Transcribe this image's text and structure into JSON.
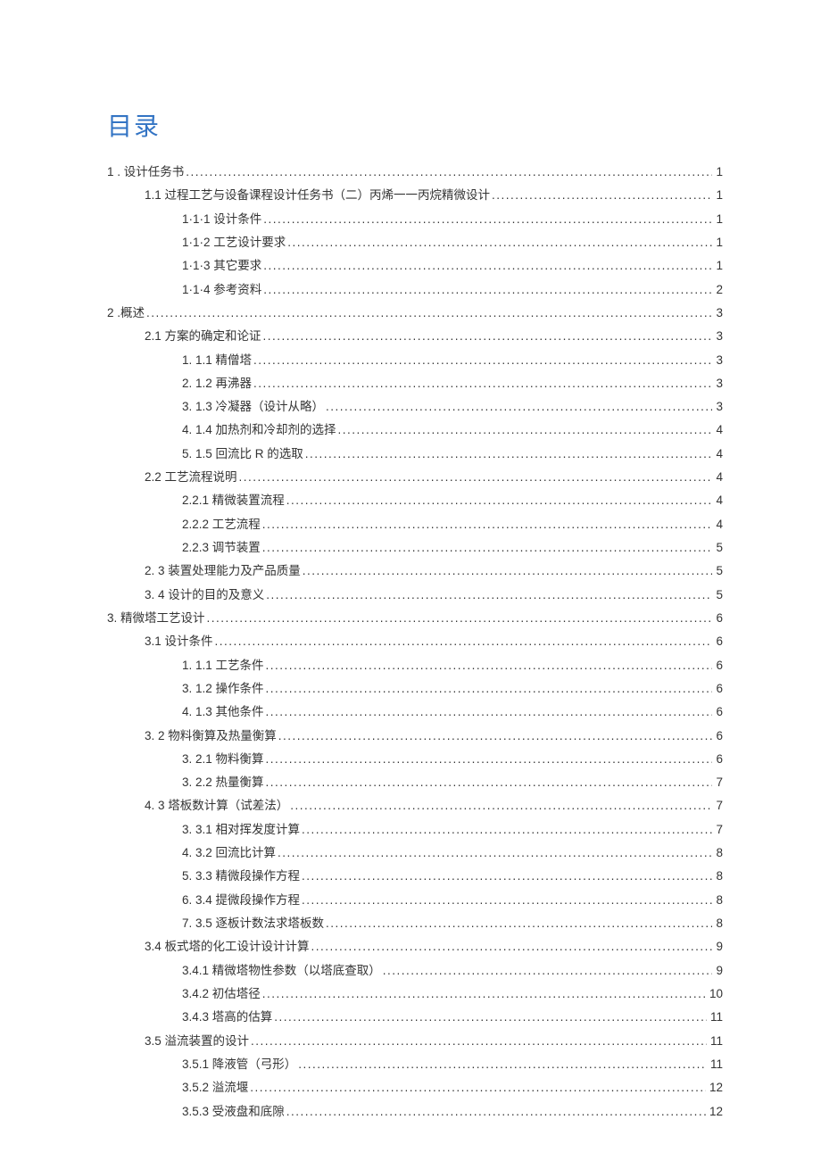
{
  "title": "目录",
  "entries": [
    {
      "indent": 0,
      "label": "1  . 设计任务书",
      "page": "1"
    },
    {
      "indent": 1,
      "label": "1.1   过程工艺与设备课程设计任务书（二）丙烯一一丙烷精微设计 ",
      "page": "1"
    },
    {
      "indent": 2,
      "label": "1·1·1 设计条件 ",
      "page": "1"
    },
    {
      "indent": 2,
      "label": "1·1·2 工艺设计要求 ",
      "page": "1"
    },
    {
      "indent": 2,
      "label": "1·1·3 其它要求 ",
      "page": "1"
    },
    {
      "indent": 2,
      "label": "1·1·4 参考资料 ",
      "page": "2"
    },
    {
      "indent": 0,
      "label": "2    .概述",
      "page": "3"
    },
    {
      "indent": 1,
      "label": "2.1   方案的确定和论证 ",
      "page": "3"
    },
    {
      "indent": 2,
      "label": "1.   1.1 精僧塔 ",
      "page": "3"
    },
    {
      "indent": 2,
      "label": "2.   1.2 再沸器 ",
      "page": "3"
    },
    {
      "indent": 2,
      "label": "3.   1.3 冷凝器（设计从略） ",
      "page": "3"
    },
    {
      "indent": 2,
      "label": "4.   1.4 加热剂和冷却剂的选择 ",
      "page": "4"
    },
    {
      "indent": 2,
      "label": "5.   1.5 回流比 R 的选取 ",
      "page": "4"
    },
    {
      "indent": 1,
      "label": "2.2 工艺流程说明 ",
      "page": "4"
    },
    {
      "indent": 2,
      "label": "2.2.1 精微装置流程 ",
      "page": "4"
    },
    {
      "indent": 2,
      "label": "2.2.2 工艺流程 ",
      "page": "4"
    },
    {
      "indent": 2,
      "label": "2.2.3 调节装置 ",
      "page": "5"
    },
    {
      "indent": 1,
      "label": "2.   3 装置处理能力及产品质量 ",
      "page": "5"
    },
    {
      "indent": 1,
      "label": "3.   4 设计的目的及意义 ",
      "page": "5"
    },
    {
      "indent": 0,
      "label": "3. 精微塔工艺设计",
      "page": "6"
    },
    {
      "indent": 1,
      "label": "3.1    设计条件 ",
      "page": "6"
    },
    {
      "indent": 2,
      "label": "1.   1.1 工艺条件 ",
      "page": "6"
    },
    {
      "indent": 2,
      "label": "3.   1.2 操作条件 ",
      "page": "6"
    },
    {
      "indent": 2,
      "label": "4.   1.3 其他条件 ",
      "page": "6"
    },
    {
      "indent": 1,
      "label": "3.   2 物料衡算及热量衡算 ",
      "page": "6"
    },
    {
      "indent": 2,
      "label": "3.   2.1 物料衡算 ",
      "page": "6"
    },
    {
      "indent": 2,
      "label": "3.   2.2 热量衡算 ",
      "page": "7"
    },
    {
      "indent": 1,
      "label": "4.   3 塔板数计算（试差法） ",
      "page": "7"
    },
    {
      "indent": 2,
      "label": "3.   3.1 相对挥发度计算 ",
      "page": "7"
    },
    {
      "indent": 2,
      "label": "4.   3.2 回流比计算 ",
      "page": "8"
    },
    {
      "indent": 2,
      "label": "5.   3.3 精微段操作方程 ",
      "page": "8"
    },
    {
      "indent": 2,
      "label": "6.   3.4 提微段操作方程 ",
      "page": "8"
    },
    {
      "indent": 2,
      "label": "7.   3.5 逐板计数法求塔板数 ",
      "page": "8"
    },
    {
      "indent": 1,
      "label": "3.4 板式塔的化工设计设计计算 ",
      "page": "9"
    },
    {
      "indent": 2,
      "label": "3.4.1 精微塔物性参数（以塔底查取） ",
      "page": "9"
    },
    {
      "indent": 2,
      "label": "3.4.2 初估塔径 ",
      "page": "10"
    },
    {
      "indent": 2,
      "label": "3.4.3 塔高的估算 ",
      "page": "11"
    },
    {
      "indent": 1,
      "label": "3.5 溢流装置的设计 ",
      "page": "11"
    },
    {
      "indent": 2,
      "label": "3.5.1 降液管（弓形） ",
      "page": "11"
    },
    {
      "indent": 2,
      "label": "3.5.2 溢流堰 ",
      "page": "12"
    },
    {
      "indent": 2,
      "label": "3.5.3 受液盘和底隙 ",
      "page": "12"
    }
  ]
}
